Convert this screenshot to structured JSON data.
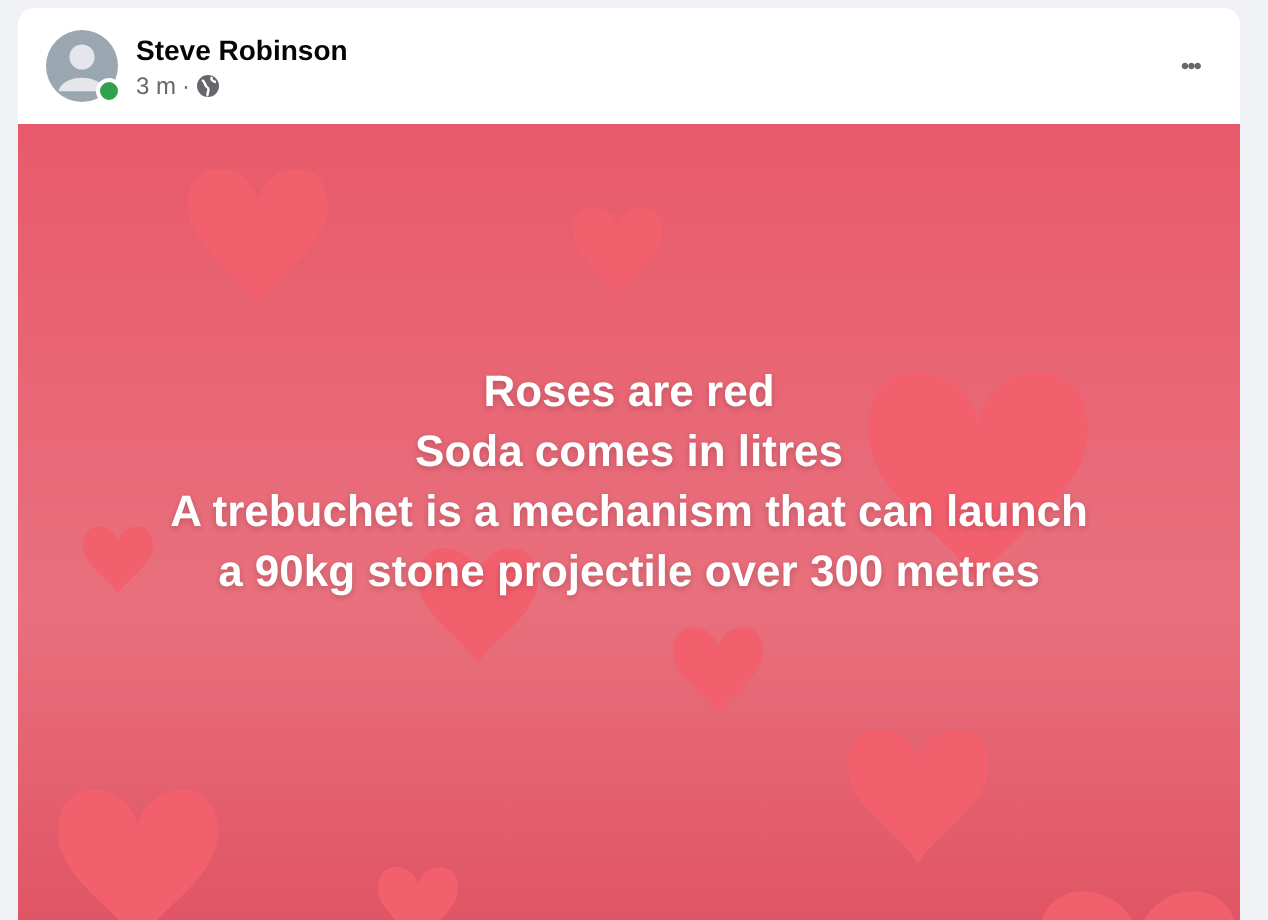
{
  "post": {
    "author": "Steve Robinson",
    "online": true,
    "time": "3 m",
    "separator": "·",
    "menu": "•••",
    "lines": [
      "Roses are red",
      "Soda comes in litres",
      "A trebuchet is a mechanism that can launch",
      "a 90kg stone projectile over 300 metres"
    ]
  }
}
